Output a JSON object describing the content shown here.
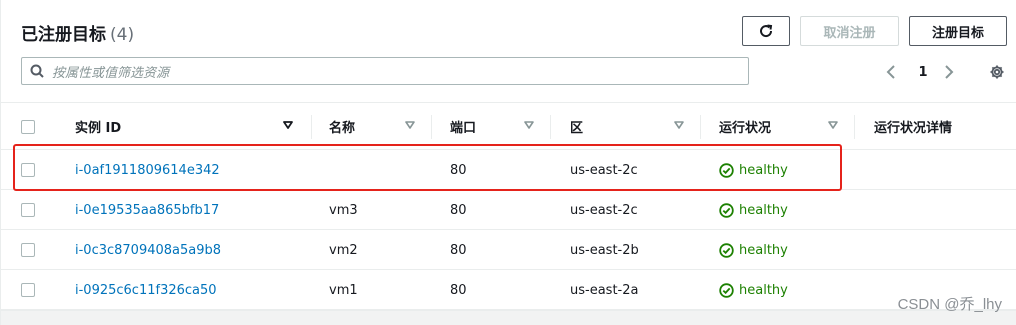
{
  "header": {
    "title": "已注册目标",
    "count": "(4)",
    "refresh_label": "",
    "deregister_label": "取消注册",
    "register_label": "注册目标"
  },
  "search": {
    "placeholder": "按属性或值筛选资源"
  },
  "pagination": {
    "current_page": "1"
  },
  "table": {
    "columns": [
      "实例 ID",
      "名称",
      "端口",
      "区",
      "运行状况",
      "运行状况详情"
    ],
    "rows": [
      {
        "instance_id": "i-0af1911809614e342",
        "name": "",
        "port": "80",
        "zone": "us-east-2c",
        "health": "healthy",
        "details": ""
      },
      {
        "instance_id": "i-0e19535aa865bfb17",
        "name": "vm3",
        "port": "80",
        "zone": "us-east-2c",
        "health": "healthy",
        "details": ""
      },
      {
        "instance_id": "i-0c3c8709408a5a9b8",
        "name": "vm2",
        "port": "80",
        "zone": "us-east-2b",
        "health": "healthy",
        "details": ""
      },
      {
        "instance_id": "i-0925c6c11f326ca50",
        "name": "vm1",
        "port": "80",
        "zone": "us-east-2a",
        "health": "healthy",
        "details": ""
      }
    ]
  },
  "colors": {
    "link": "#0073bb",
    "healthy": "#1d8102",
    "highlight": "#e5231b"
  },
  "watermark": "CSDN @乔_lhy"
}
